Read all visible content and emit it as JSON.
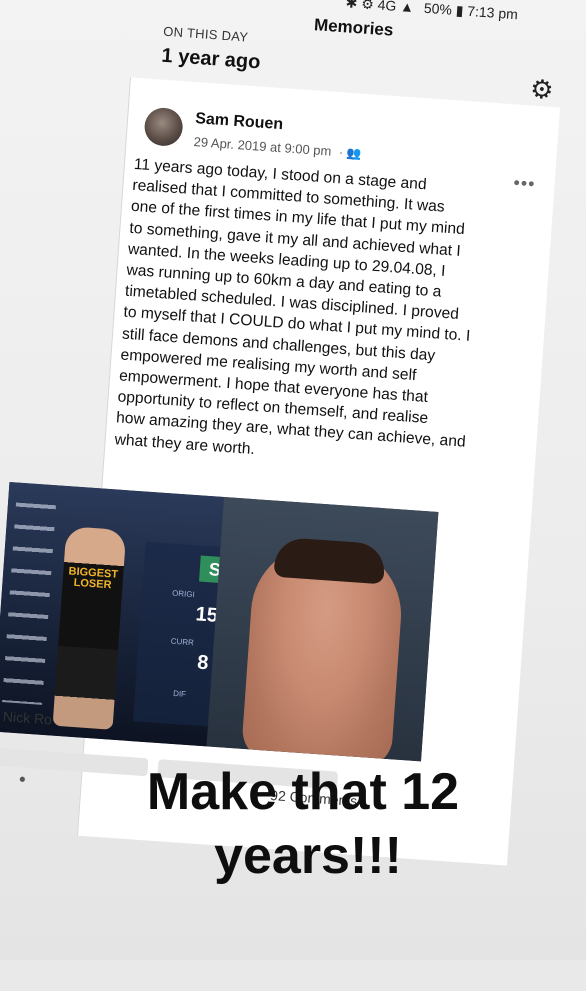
{
  "status_bar": {
    "icons": "✱ ⚙ 4G ▲",
    "battery": "50%",
    "time": "7:13 pm"
  },
  "header": {
    "title": "Memories",
    "section": "ON THIS DAY",
    "ago": "1 year ago"
  },
  "post": {
    "author": "Sam Rouen",
    "date": "29 Apr. 2019 at 9:00 pm",
    "privacy": "friends",
    "lines": [
      "11 years ago today, I stood on a stage and",
      "realised that I committed to something. It was",
      "one of the first times in my life that I put my mind",
      "to something, gave it my all and achieved what I",
      "wanted. In the weeks leading up to 29.04.08, I",
      "was running up to 60km a day and eating to a",
      "timetabled scheduled. I was disciplined. I proved",
      "to myself that I COULD do what I put my mind to. I",
      "still face demons and challenges, but this day",
      "empowered me realising my worth and self",
      "empowerment. I hope that everyone has that",
      "opportunity to reflect on themself, and realise",
      "how amazing they are, what they can achieve, and",
      "what they are worth."
    ],
    "photo": {
      "shirt_text": "BIGGEST LOSER",
      "scoreboard_s": "S",
      "scoreboard_orig": "ORIGI",
      "scoreboard_num1": "15",
      "scoreboard_curr": "CURR",
      "scoreboard_num2": "8",
      "scoreboard_dif": "DIF"
    },
    "reactions_text": "Nick Ro",
    "comments": "92 Comments"
  },
  "overlay": {
    "line1": "Make that 12",
    "line2": "years!!!"
  }
}
